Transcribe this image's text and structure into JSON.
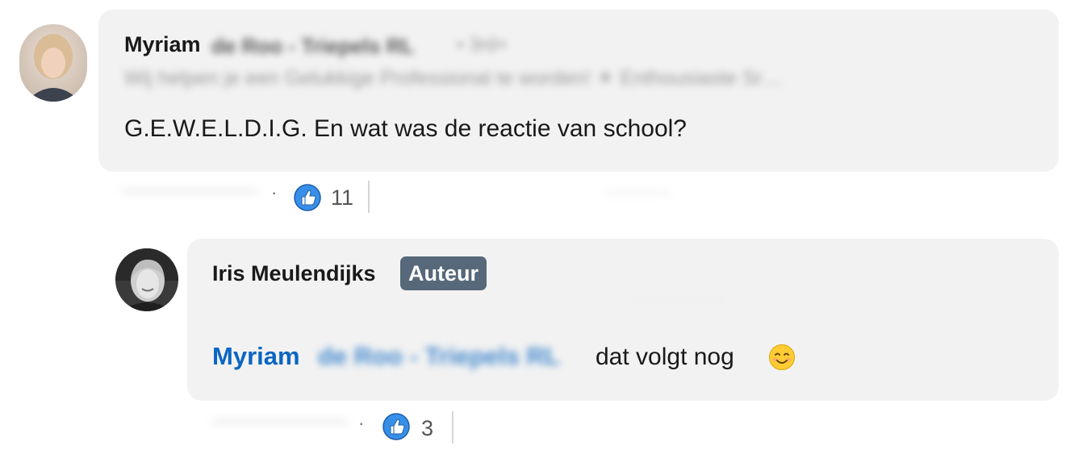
{
  "comments": [
    {
      "author": "Myriam",
      "author_rest_blurred": "de Roo - Triepels RL",
      "degree_blurred": "• 3rd+",
      "headline_blurred": "Wij helpen je een Gelukkige Professional te worden! ☀ Enthousiaste Sr…",
      "text": "G.E.W.E.L.D.I.G. En wat was de reactie van school?",
      "reactions": {
        "dot": "·",
        "count": "11",
        "icon": "like-icon"
      }
    },
    {
      "author": "Iris Meulendijks",
      "badge": "Auteur",
      "mention_first": "Myriam",
      "mention_rest_blurred": "de Roo - Triepels RL",
      "text": "dat volgt nog",
      "emoji": "smiling-face-emoji",
      "reactions": {
        "dot": "·",
        "count": "3",
        "icon": "like-icon"
      }
    }
  ]
}
